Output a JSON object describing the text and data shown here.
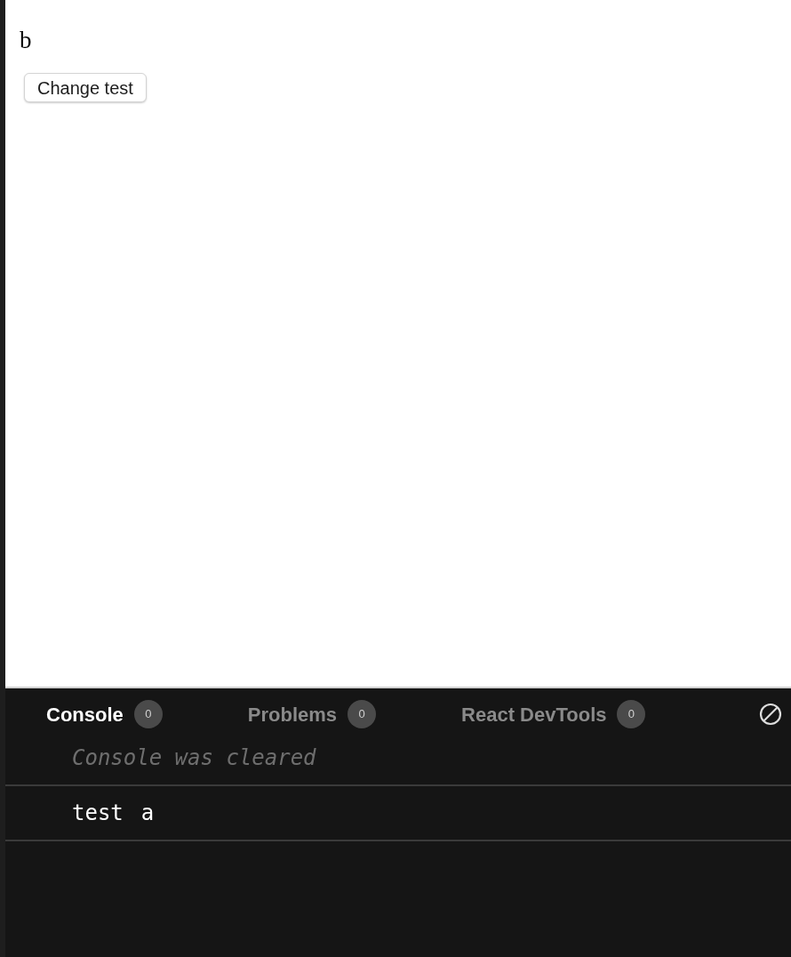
{
  "preview": {
    "heading": "b",
    "button": "Change test"
  },
  "console": {
    "tabs": [
      {
        "label": "Console",
        "count": "0",
        "selected": true
      },
      {
        "label": "Problems",
        "count": "0",
        "selected": false
      },
      {
        "label": "React DevTools",
        "count": "0",
        "selected": false
      }
    ],
    "entries": [
      {
        "kind": "info",
        "args": [
          "Console was cleared"
        ]
      },
      {
        "kind": "log",
        "args": [
          "test",
          "a"
        ]
      }
    ]
  }
}
